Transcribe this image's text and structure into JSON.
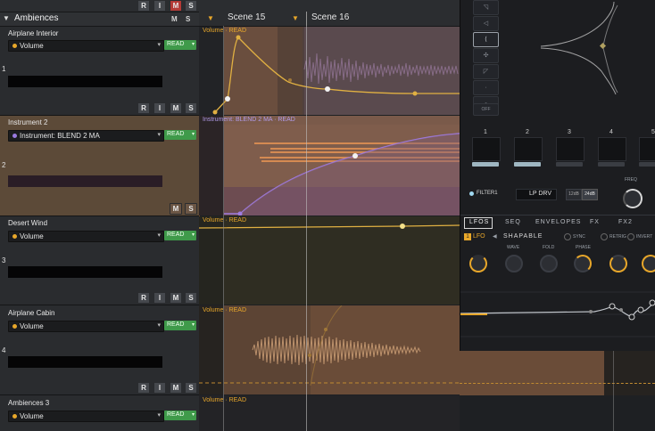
{
  "header_buttons": {
    "r": "R",
    "i": "I",
    "m": "M",
    "s": "S"
  },
  "group": {
    "title": "Ambiences",
    "m": "M",
    "s": "S"
  },
  "timeline": {
    "scene1": "Scene 15",
    "scene2": "Scene 16"
  },
  "tracks": [
    {
      "name": "Airplane Interior",
      "number": "1",
      "param": "Volume",
      "mode": "READ",
      "auto_label": "Volume · READ",
      "dot": "#e8a72a"
    },
    {
      "name": "Instrument 2",
      "number": "2",
      "param": "Instrument: BLEND 2 MA",
      "mode": "READ",
      "auto_label": "Instrument: BLEND 2 MA · READ",
      "dot": "#9a7ae0"
    },
    {
      "name": "Desert Wind",
      "number": "3",
      "param": "Volume",
      "mode": "READ",
      "auto_label": "Volume · READ",
      "dot": "#e8a72a"
    },
    {
      "name": "Airplane Cabin",
      "number": "4",
      "param": "Volume",
      "mode": "READ",
      "auto_label": "Volume · READ",
      "dot": "#e8a72a"
    },
    {
      "name": "Ambiences 3",
      "number": "",
      "param": "Volume",
      "mode": "READ",
      "auto_label": "Volume · READ",
      "dot": "#e8a72a"
    }
  ],
  "track_buttons": {
    "r": "R",
    "i": "I",
    "m": "M",
    "s": "S"
  },
  "plugin": {
    "shape_buttons": [
      "",
      "",
      "",
      "",
      "",
      "",
      "",
      "OFF"
    ],
    "slots": [
      "1",
      "2",
      "3",
      "4",
      "5"
    ],
    "filter": {
      "label": "FILTER1",
      "type": "LP DRV",
      "db12": "12dB",
      "db24": "24dB",
      "freq": "FREQ"
    },
    "tabs": [
      "LFOS",
      "SEQ",
      "ENVELOPES",
      "FX",
      "FX2"
    ],
    "lfo": {
      "label": "LFO",
      "badge": "1",
      "mode": "SHAPABLE",
      "options": [
        "SYNC",
        "RETRIG",
        "INVERT"
      ]
    },
    "knobs": [
      "",
      "WAVE",
      "FOLD",
      "PHASE",
      "",
      ""
    ]
  },
  "colors": {
    "accent_orange": "#e8a72a",
    "purple": "#9a7ae0",
    "read_green": "#3f9a4a",
    "mute_red": "#b43a36"
  }
}
